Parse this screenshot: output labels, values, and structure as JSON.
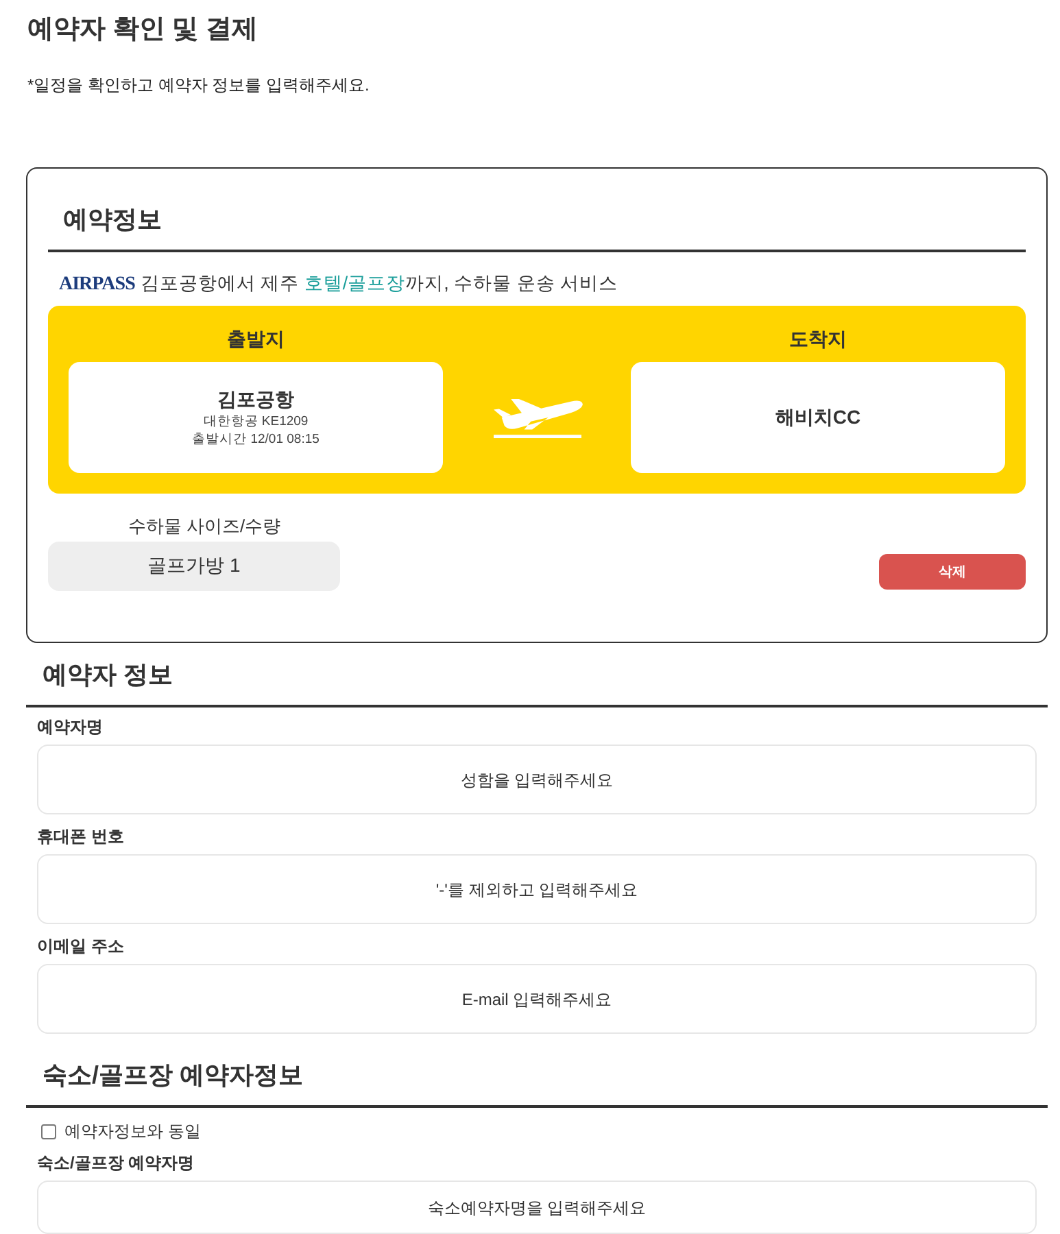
{
  "page": {
    "title": "예약자 확인 및 결제",
    "notice": "*일정을 확인하고 예약자 정보를 입력해주세요."
  },
  "reservation": {
    "title": "예약정보",
    "logo": "AIRPASS",
    "tagline": {
      "before": "김포공항에서 제주 ",
      "highlight": "호텔/골프장",
      "after": "까지, 수하물 운송 서비스"
    },
    "route": {
      "departure": {
        "label": "출발지",
        "place": "김포공항",
        "lines": [
          "대한항공 KE1209",
          "출발시간 12/01 08:15"
        ]
      },
      "arrival": {
        "label": "도착지",
        "place": "해비치CC"
      }
    },
    "baggage": {
      "label": "수하물 사이즈/수량",
      "items": [
        {
          "text": "골프가방 1"
        }
      ],
      "delete_button": "삭제"
    }
  },
  "booker": {
    "title": "예약자 정보",
    "fields": [
      {
        "label": "예약자명",
        "placeholder": "성함을 입력해주세요"
      },
      {
        "label": "휴대폰 번호",
        "placeholder": "'-'를 제외하고 입력해주세요"
      },
      {
        "label": "이메일 주소",
        "placeholder": "E-mail 입력해주세요"
      }
    ]
  },
  "lodging": {
    "title": "숙소/골프장 예약자정보",
    "same_as_booker": {
      "label": "예약자정보와 동일",
      "checked": false
    },
    "fields": [
      {
        "label": "숙소/골프장 예약자명",
        "placeholder": "숙소예약자명을 입력해주세요"
      }
    ]
  }
}
